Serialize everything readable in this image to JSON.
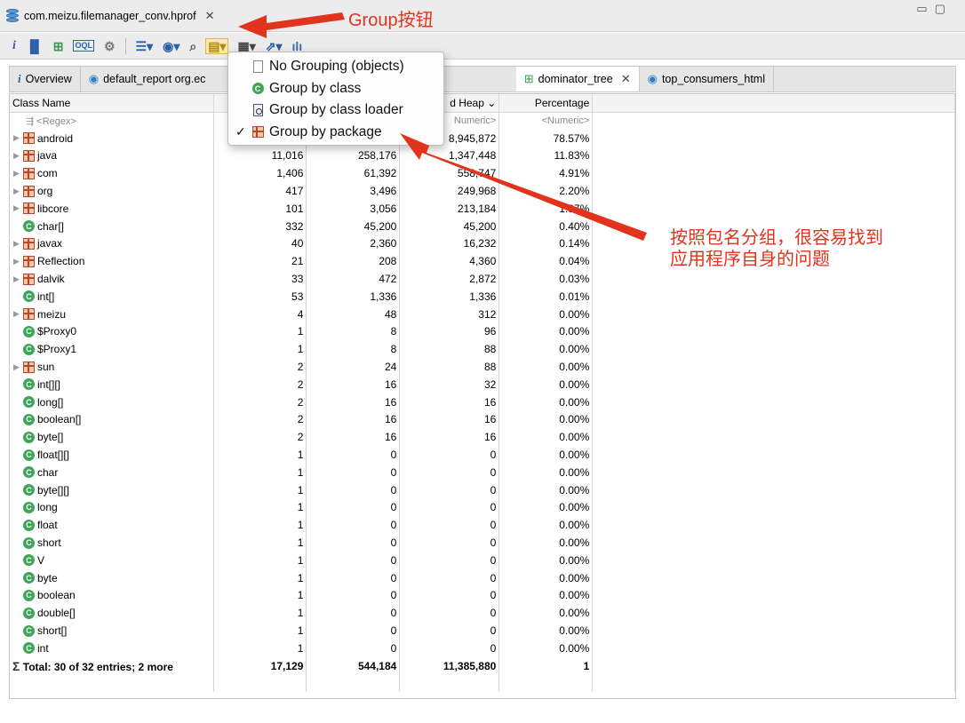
{
  "window": {
    "title": "com.meizu.filemanager_conv.hprof"
  },
  "toolbar": {
    "icons": [
      "info-icon",
      "histogram-icon",
      "dominator-tree-icon",
      "oql-icon",
      "gear-icon",
      "query-browser-icon",
      "report-icon",
      "search-icon",
      "group-icon",
      "calculate-icon",
      "export-icon",
      "chart-icon"
    ]
  },
  "tabs": [
    {
      "label": "Overview",
      "icon": "info-icon"
    },
    {
      "label": "default_report  org.ec",
      "icon": "report-icon"
    },
    {
      "label": "dominator_tree",
      "icon": "dominator-tree-icon",
      "active": true
    },
    {
      "label": "top_consumers_html",
      "icon": "report-icon"
    }
  ],
  "menu": {
    "items": [
      {
        "label": "No Grouping (objects)",
        "icon": "document-icon",
        "checked": false
      },
      {
        "label": "Group by class",
        "icon": "class-icon",
        "checked": false
      },
      {
        "label": "Group by class loader",
        "icon": "class-loader-icon",
        "checked": false
      },
      {
        "label": "Group by package",
        "icon": "package-icon",
        "checked": true
      }
    ],
    "check_mark": "✓"
  },
  "table": {
    "columns": [
      "Class Name",
      "",
      "",
      "d Heap",
      "Percentage"
    ],
    "sort_indicator": "⌄",
    "filter": [
      "<Regex>",
      "",
      "",
      "Numeric>",
      "<Numeric>"
    ],
    "rows": [
      {
        "name": "android",
        "type": "package",
        "objects": "",
        "shallow": "",
        "retained": "8,945,872",
        "percent": "78.57%"
      },
      {
        "name": "java",
        "type": "package",
        "objects": "11,016",
        "shallow": "258,176",
        "retained": "1,347,448",
        "percent": "11.83%"
      },
      {
        "name": "com",
        "type": "package",
        "objects": "1,406",
        "shallow": "61,392",
        "retained": "558,747",
        "percent": "4.91%"
      },
      {
        "name": "org",
        "type": "package",
        "objects": "417",
        "shallow": "3,496",
        "retained": "249,968",
        "percent": "2.20%"
      },
      {
        "name": "libcore",
        "type": "package",
        "objects": "101",
        "shallow": "3,056",
        "retained": "213,184",
        "percent": "1.87%"
      },
      {
        "name": "char[]",
        "type": "class",
        "objects": "332",
        "shallow": "45,200",
        "retained": "45,200",
        "percent": "0.40%"
      },
      {
        "name": "javax",
        "type": "package",
        "objects": "40",
        "shallow": "2,360",
        "retained": "16,232",
        "percent": "0.14%"
      },
      {
        "name": "Reflection",
        "type": "package",
        "objects": "21",
        "shallow": "208",
        "retained": "4,360",
        "percent": "0.04%"
      },
      {
        "name": "dalvik",
        "type": "package",
        "objects": "33",
        "shallow": "472",
        "retained": "2,872",
        "percent": "0.03%"
      },
      {
        "name": "int[]",
        "type": "class",
        "objects": "53",
        "shallow": "1,336",
        "retained": "1,336",
        "percent": "0.01%"
      },
      {
        "name": "meizu",
        "type": "package",
        "objects": "4",
        "shallow": "48",
        "retained": "312",
        "percent": "0.00%"
      },
      {
        "name": "$Proxy0",
        "type": "class",
        "objects": "1",
        "shallow": "8",
        "retained": "96",
        "percent": "0.00%"
      },
      {
        "name": "$Proxy1",
        "type": "class",
        "objects": "1",
        "shallow": "8",
        "retained": "88",
        "percent": "0.00%"
      },
      {
        "name": "sun",
        "type": "package",
        "objects": "2",
        "shallow": "24",
        "retained": "88",
        "percent": "0.00%"
      },
      {
        "name": "int[][]",
        "type": "class",
        "objects": "2",
        "shallow": "16",
        "retained": "32",
        "percent": "0.00%"
      },
      {
        "name": "long[]",
        "type": "class",
        "objects": "2",
        "shallow": "16",
        "retained": "16",
        "percent": "0.00%"
      },
      {
        "name": "boolean[]",
        "type": "class",
        "objects": "2",
        "shallow": "16",
        "retained": "16",
        "percent": "0.00%"
      },
      {
        "name": "byte[]",
        "type": "class",
        "objects": "2",
        "shallow": "16",
        "retained": "16",
        "percent": "0.00%"
      },
      {
        "name": "float[][]",
        "type": "class",
        "objects": "1",
        "shallow": "0",
        "retained": "0",
        "percent": "0.00%"
      },
      {
        "name": "char",
        "type": "class",
        "objects": "1",
        "shallow": "0",
        "retained": "0",
        "percent": "0.00%"
      },
      {
        "name": "byte[][]",
        "type": "class",
        "objects": "1",
        "shallow": "0",
        "retained": "0",
        "percent": "0.00%"
      },
      {
        "name": "long",
        "type": "class",
        "objects": "1",
        "shallow": "0",
        "retained": "0",
        "percent": "0.00%"
      },
      {
        "name": "float",
        "type": "class",
        "objects": "1",
        "shallow": "0",
        "retained": "0",
        "percent": "0.00%"
      },
      {
        "name": "short",
        "type": "class",
        "objects": "1",
        "shallow": "0",
        "retained": "0",
        "percent": "0.00%"
      },
      {
        "name": "V",
        "type": "class",
        "objects": "1",
        "shallow": "0",
        "retained": "0",
        "percent": "0.00%"
      },
      {
        "name": "byte",
        "type": "class",
        "objects": "1",
        "shallow": "0",
        "retained": "0",
        "percent": "0.00%"
      },
      {
        "name": "boolean",
        "type": "class",
        "objects": "1",
        "shallow": "0",
        "retained": "0",
        "percent": "0.00%"
      },
      {
        "name": "double[]",
        "type": "class",
        "objects": "1",
        "shallow": "0",
        "retained": "0",
        "percent": "0.00%"
      },
      {
        "name": "short[]",
        "type": "class",
        "objects": "1",
        "shallow": "0",
        "retained": "0",
        "percent": "0.00%"
      },
      {
        "name": "int",
        "type": "class",
        "objects": "1",
        "shallow": "0",
        "retained": "0",
        "percent": "0.00%"
      }
    ],
    "total": {
      "name": "Total: 30 of 32 entries; 2 more",
      "objects": "17,129",
      "shallow": "544,184",
      "retained": "11,385,880",
      "percent": "1"
    }
  },
  "annotations": {
    "group_button": "Group按钮",
    "note_line1": "按照包名分组，很容易找到",
    "note_line2": "应用程序自身的问题",
    "color": "#e2331d"
  }
}
